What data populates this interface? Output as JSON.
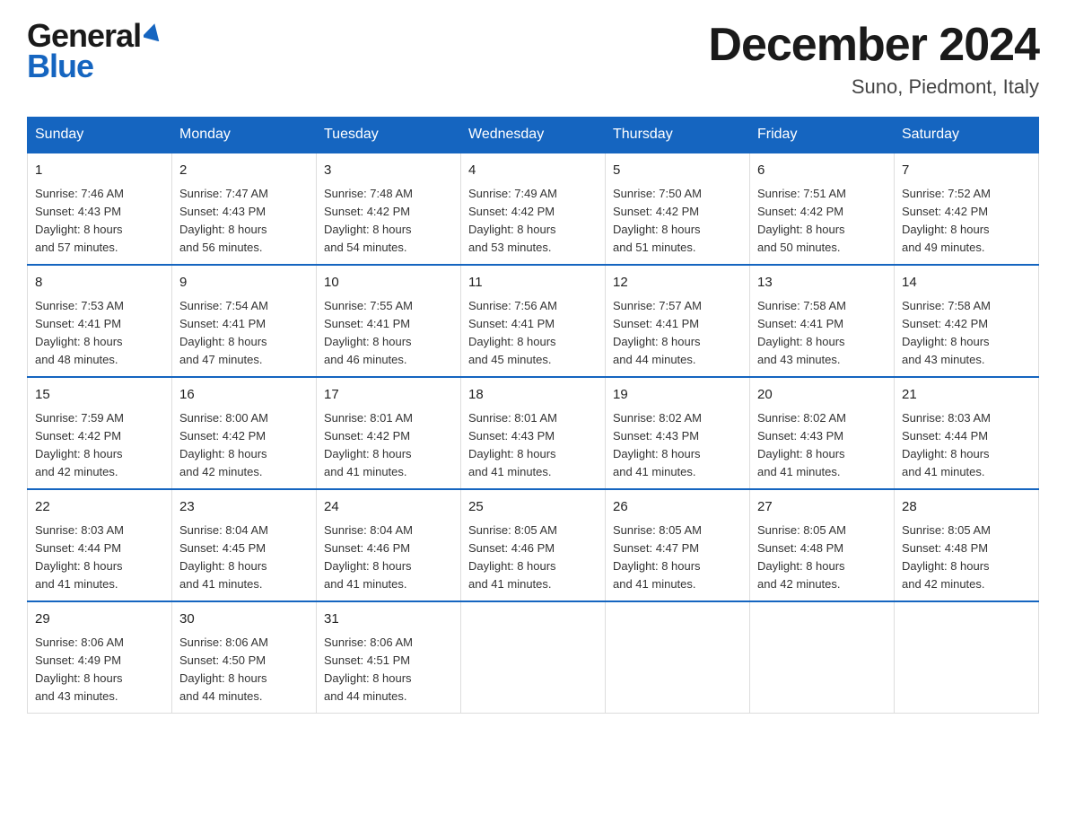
{
  "header": {
    "logo_line1": "General",
    "logo_line2": "Blue",
    "month_title": "December 2024",
    "location": "Suno, Piedmont, Italy"
  },
  "weekdays": [
    "Sunday",
    "Monday",
    "Tuesday",
    "Wednesday",
    "Thursday",
    "Friday",
    "Saturday"
  ],
  "weeks": [
    [
      {
        "day": "1",
        "sunrise": "7:46 AM",
        "sunset": "4:43 PM",
        "daylight": "8 hours and 57 minutes."
      },
      {
        "day": "2",
        "sunrise": "7:47 AM",
        "sunset": "4:43 PM",
        "daylight": "8 hours and 56 minutes."
      },
      {
        "day": "3",
        "sunrise": "7:48 AM",
        "sunset": "4:42 PM",
        "daylight": "8 hours and 54 minutes."
      },
      {
        "day": "4",
        "sunrise": "7:49 AM",
        "sunset": "4:42 PM",
        "daylight": "8 hours and 53 minutes."
      },
      {
        "day": "5",
        "sunrise": "7:50 AM",
        "sunset": "4:42 PM",
        "daylight": "8 hours and 51 minutes."
      },
      {
        "day": "6",
        "sunrise": "7:51 AM",
        "sunset": "4:42 PM",
        "daylight": "8 hours and 50 minutes."
      },
      {
        "day": "7",
        "sunrise": "7:52 AM",
        "sunset": "4:42 PM",
        "daylight": "8 hours and 49 minutes."
      }
    ],
    [
      {
        "day": "8",
        "sunrise": "7:53 AM",
        "sunset": "4:41 PM",
        "daylight": "8 hours and 48 minutes."
      },
      {
        "day": "9",
        "sunrise": "7:54 AM",
        "sunset": "4:41 PM",
        "daylight": "8 hours and 47 minutes."
      },
      {
        "day": "10",
        "sunrise": "7:55 AM",
        "sunset": "4:41 PM",
        "daylight": "8 hours and 46 minutes."
      },
      {
        "day": "11",
        "sunrise": "7:56 AM",
        "sunset": "4:41 PM",
        "daylight": "8 hours and 45 minutes."
      },
      {
        "day": "12",
        "sunrise": "7:57 AM",
        "sunset": "4:41 PM",
        "daylight": "8 hours and 44 minutes."
      },
      {
        "day": "13",
        "sunrise": "7:58 AM",
        "sunset": "4:41 PM",
        "daylight": "8 hours and 43 minutes."
      },
      {
        "day": "14",
        "sunrise": "7:58 AM",
        "sunset": "4:42 PM",
        "daylight": "8 hours and 43 minutes."
      }
    ],
    [
      {
        "day": "15",
        "sunrise": "7:59 AM",
        "sunset": "4:42 PM",
        "daylight": "8 hours and 42 minutes."
      },
      {
        "day": "16",
        "sunrise": "8:00 AM",
        "sunset": "4:42 PM",
        "daylight": "8 hours and 42 minutes."
      },
      {
        "day": "17",
        "sunrise": "8:01 AM",
        "sunset": "4:42 PM",
        "daylight": "8 hours and 41 minutes."
      },
      {
        "day": "18",
        "sunrise": "8:01 AM",
        "sunset": "4:43 PM",
        "daylight": "8 hours and 41 minutes."
      },
      {
        "day": "19",
        "sunrise": "8:02 AM",
        "sunset": "4:43 PM",
        "daylight": "8 hours and 41 minutes."
      },
      {
        "day": "20",
        "sunrise": "8:02 AM",
        "sunset": "4:43 PM",
        "daylight": "8 hours and 41 minutes."
      },
      {
        "day": "21",
        "sunrise": "8:03 AM",
        "sunset": "4:44 PM",
        "daylight": "8 hours and 41 minutes."
      }
    ],
    [
      {
        "day": "22",
        "sunrise": "8:03 AM",
        "sunset": "4:44 PM",
        "daylight": "8 hours and 41 minutes."
      },
      {
        "day": "23",
        "sunrise": "8:04 AM",
        "sunset": "4:45 PM",
        "daylight": "8 hours and 41 minutes."
      },
      {
        "day": "24",
        "sunrise": "8:04 AM",
        "sunset": "4:46 PM",
        "daylight": "8 hours and 41 minutes."
      },
      {
        "day": "25",
        "sunrise": "8:05 AM",
        "sunset": "4:46 PM",
        "daylight": "8 hours and 41 minutes."
      },
      {
        "day": "26",
        "sunrise": "8:05 AM",
        "sunset": "4:47 PM",
        "daylight": "8 hours and 41 minutes."
      },
      {
        "day": "27",
        "sunrise": "8:05 AM",
        "sunset": "4:48 PM",
        "daylight": "8 hours and 42 minutes."
      },
      {
        "day": "28",
        "sunrise": "8:05 AM",
        "sunset": "4:48 PM",
        "daylight": "8 hours and 42 minutes."
      }
    ],
    [
      {
        "day": "29",
        "sunrise": "8:06 AM",
        "sunset": "4:49 PM",
        "daylight": "8 hours and 43 minutes."
      },
      {
        "day": "30",
        "sunrise": "8:06 AM",
        "sunset": "4:50 PM",
        "daylight": "8 hours and 44 minutes."
      },
      {
        "day": "31",
        "sunrise": "8:06 AM",
        "sunset": "4:51 PM",
        "daylight": "8 hours and 44 minutes."
      },
      null,
      null,
      null,
      null
    ]
  ],
  "labels": {
    "sunrise": "Sunrise:",
    "sunset": "Sunset:",
    "daylight": "Daylight:"
  }
}
